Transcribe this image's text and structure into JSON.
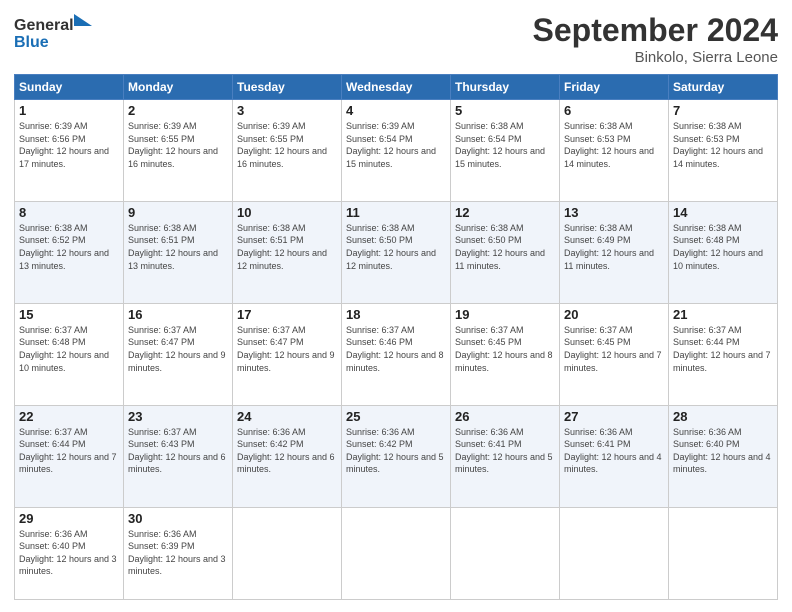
{
  "header": {
    "logo_line1": "General",
    "logo_line2": "Blue",
    "month_title": "September 2024",
    "location": "Binkolo, Sierra Leone"
  },
  "weekdays": [
    "Sunday",
    "Monday",
    "Tuesday",
    "Wednesday",
    "Thursday",
    "Friday",
    "Saturday"
  ],
  "weeks": [
    [
      {
        "day": "1",
        "sunrise": "6:39 AM",
        "sunset": "6:56 PM",
        "daylight": "12 hours and 17 minutes."
      },
      {
        "day": "2",
        "sunrise": "6:39 AM",
        "sunset": "6:55 PM",
        "daylight": "12 hours and 16 minutes."
      },
      {
        "day": "3",
        "sunrise": "6:39 AM",
        "sunset": "6:55 PM",
        "daylight": "12 hours and 16 minutes."
      },
      {
        "day": "4",
        "sunrise": "6:39 AM",
        "sunset": "6:54 PM",
        "daylight": "12 hours and 15 minutes."
      },
      {
        "day": "5",
        "sunrise": "6:38 AM",
        "sunset": "6:54 PM",
        "daylight": "12 hours and 15 minutes."
      },
      {
        "day": "6",
        "sunrise": "6:38 AM",
        "sunset": "6:53 PM",
        "daylight": "12 hours and 14 minutes."
      },
      {
        "day": "7",
        "sunrise": "6:38 AM",
        "sunset": "6:53 PM",
        "daylight": "12 hours and 14 minutes."
      }
    ],
    [
      {
        "day": "8",
        "sunrise": "6:38 AM",
        "sunset": "6:52 PM",
        "daylight": "12 hours and 13 minutes."
      },
      {
        "day": "9",
        "sunrise": "6:38 AM",
        "sunset": "6:51 PM",
        "daylight": "12 hours and 13 minutes."
      },
      {
        "day": "10",
        "sunrise": "6:38 AM",
        "sunset": "6:51 PM",
        "daylight": "12 hours and 12 minutes."
      },
      {
        "day": "11",
        "sunrise": "6:38 AM",
        "sunset": "6:50 PM",
        "daylight": "12 hours and 12 minutes."
      },
      {
        "day": "12",
        "sunrise": "6:38 AM",
        "sunset": "6:50 PM",
        "daylight": "12 hours and 11 minutes."
      },
      {
        "day": "13",
        "sunrise": "6:38 AM",
        "sunset": "6:49 PM",
        "daylight": "12 hours and 11 minutes."
      },
      {
        "day": "14",
        "sunrise": "6:38 AM",
        "sunset": "6:48 PM",
        "daylight": "12 hours and 10 minutes."
      }
    ],
    [
      {
        "day": "15",
        "sunrise": "6:37 AM",
        "sunset": "6:48 PM",
        "daylight": "12 hours and 10 minutes."
      },
      {
        "day": "16",
        "sunrise": "6:37 AM",
        "sunset": "6:47 PM",
        "daylight": "12 hours and 9 minutes."
      },
      {
        "day": "17",
        "sunrise": "6:37 AM",
        "sunset": "6:47 PM",
        "daylight": "12 hours and 9 minutes."
      },
      {
        "day": "18",
        "sunrise": "6:37 AM",
        "sunset": "6:46 PM",
        "daylight": "12 hours and 8 minutes."
      },
      {
        "day": "19",
        "sunrise": "6:37 AM",
        "sunset": "6:45 PM",
        "daylight": "12 hours and 8 minutes."
      },
      {
        "day": "20",
        "sunrise": "6:37 AM",
        "sunset": "6:45 PM",
        "daylight": "12 hours and 7 minutes."
      },
      {
        "day": "21",
        "sunrise": "6:37 AM",
        "sunset": "6:44 PM",
        "daylight": "12 hours and 7 minutes."
      }
    ],
    [
      {
        "day": "22",
        "sunrise": "6:37 AM",
        "sunset": "6:44 PM",
        "daylight": "12 hours and 7 minutes."
      },
      {
        "day": "23",
        "sunrise": "6:37 AM",
        "sunset": "6:43 PM",
        "daylight": "12 hours and 6 minutes."
      },
      {
        "day": "24",
        "sunrise": "6:36 AM",
        "sunset": "6:42 PM",
        "daylight": "12 hours and 6 minutes."
      },
      {
        "day": "25",
        "sunrise": "6:36 AM",
        "sunset": "6:42 PM",
        "daylight": "12 hours and 5 minutes."
      },
      {
        "day": "26",
        "sunrise": "6:36 AM",
        "sunset": "6:41 PM",
        "daylight": "12 hours and 5 minutes."
      },
      {
        "day": "27",
        "sunrise": "6:36 AM",
        "sunset": "6:41 PM",
        "daylight": "12 hours and 4 minutes."
      },
      {
        "day": "28",
        "sunrise": "6:36 AM",
        "sunset": "6:40 PM",
        "daylight": "12 hours and 4 minutes."
      }
    ],
    [
      {
        "day": "29",
        "sunrise": "6:36 AM",
        "sunset": "6:40 PM",
        "daylight": "12 hours and 3 minutes."
      },
      {
        "day": "30",
        "sunrise": "6:36 AM",
        "sunset": "6:39 PM",
        "daylight": "12 hours and 3 minutes."
      },
      null,
      null,
      null,
      null,
      null
    ]
  ],
  "labels": {
    "sunrise": "Sunrise:",
    "sunset": "Sunset:",
    "daylight": "Daylight:"
  }
}
